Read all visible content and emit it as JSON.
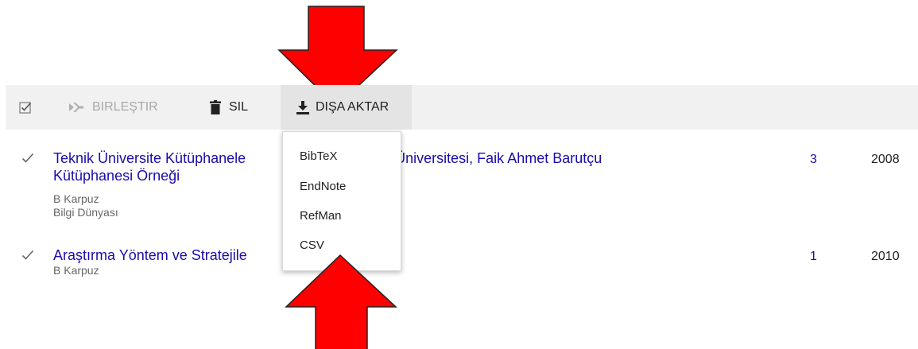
{
  "toolbar": {
    "merge_label": "BIRLEŞTIR",
    "delete_label": "SIL",
    "export_label": "DIŞA AKTAR"
  },
  "results": [
    {
      "title_line1": "Teknik Üniversite Kütüphanele",
      "title_line1_rest": "knik Üniversitesi, Faik Ahmet Barutçu",
      "title_line2": "Kütüphanesi Örneği",
      "author": "B Karpuz",
      "source": "Bilgi Dünyası",
      "cited_by": "3",
      "year": "2008"
    },
    {
      "title_line1": "Araştırma Yöntem ve Stratejile",
      "author": "B Karpuz",
      "cited_by": "1",
      "year": "2010"
    }
  ],
  "export_menu": {
    "items": [
      "BibTeX",
      "EndNote",
      "RefMan",
      "CSV"
    ]
  },
  "colors": {
    "link": "#1a0dab",
    "toolbar_bg": "#f1f1f1",
    "arrow_red": "#ff0000"
  },
  "icons": [
    "checkbox-icon",
    "merge-icon",
    "trash-icon",
    "download-icon",
    "checkmark-icon"
  ]
}
